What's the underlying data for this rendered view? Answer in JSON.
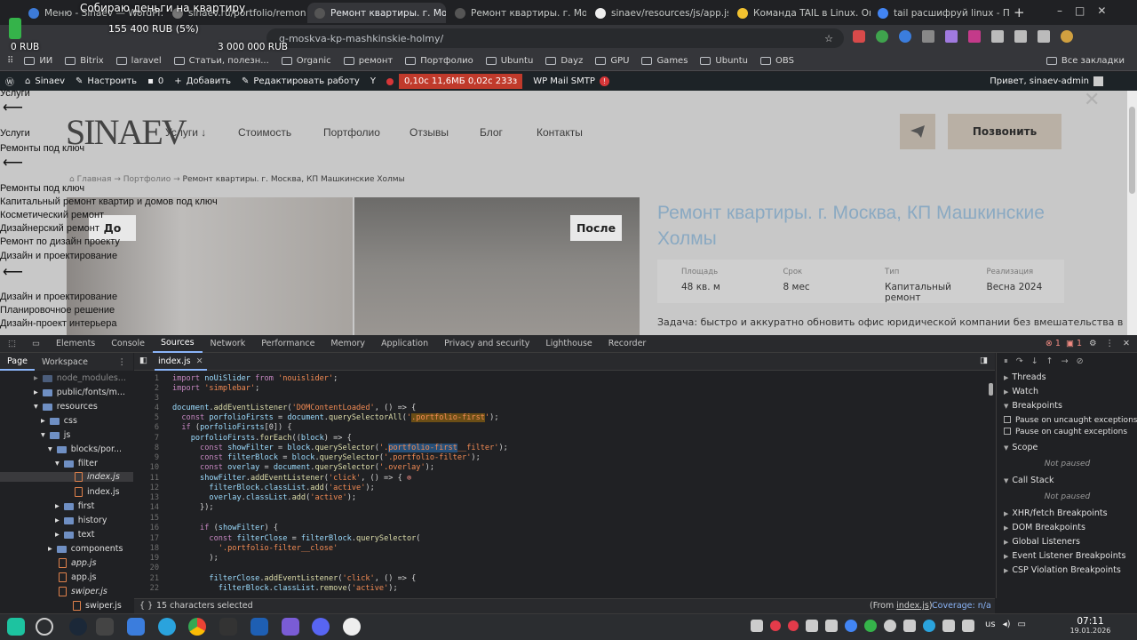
{
  "donation": {
    "title": "Собираю деньги на квартиру",
    "current": "155 400 RUB (5%)",
    "min": "0 RUB",
    "max": "3 000 000 RUB",
    "progress_percent": 5
  },
  "browser": {
    "tabs": [
      {
        "label": "Меню - Sinaev — WordPr...",
        "active": false
      },
      {
        "label": "sinaev.ru/portfolio/remont-k",
        "active": false
      },
      {
        "label": "Ремонт квартиры. г. Моск",
        "active": true
      },
      {
        "label": "Ремонт квартиры. г. Моск",
        "active": false
      },
      {
        "label": "sinaev/resources/js/app.js",
        "active": false
      },
      {
        "label": "Команда TAIL в Linux. Опи",
        "active": false
      },
      {
        "label": "tail расшифруй linux - Пои",
        "active": false
      }
    ],
    "new_tab": "+",
    "url": "g-moskva-kp-mashkinskie-holmy/",
    "bookmarks": [
      "ИИ",
      "Bitrix",
      "laravel",
      "Статьи, полезн...",
      "Organic",
      "ремонт",
      "Портфолио",
      "Ubuntu",
      "Dayz",
      "GPU",
      "Games",
      "Ubuntu",
      "OBS"
    ],
    "all_bookmarks": "Все закладки"
  },
  "wpbar": {
    "site": "Sinaev",
    "customize": "Настроить",
    "comments": "0",
    "add": "Добавить",
    "edit": "Редактировать работу",
    "qm": "0,10с  11,6МБ  0,02с  233з",
    "smtp": "WP Mail SMTP",
    "smtp_badge": "!",
    "greeting": "Привет, sinaev-admin"
  },
  "site": {
    "logo": "SINAEV",
    "nav": [
      "Услуги ↓",
      "Стоимость",
      "Портфолио",
      "Отзывы",
      "Блог",
      "Контакты"
    ],
    "call": "Позвонить",
    "breadcrumbs": {
      "home": "Главная",
      "portfolio": "Портфолио",
      "current": "Ремонт квартиры. г. Москва, КП Машкинские Холмы"
    },
    "before": "До",
    "after": "После",
    "title": "Ремонт квартиры. г. Москва, КП Машкинские Холмы",
    "stats": [
      {
        "k": "Площадь",
        "v": "48 кв. м"
      },
      {
        "k": "Срок",
        "v": "8 мес"
      },
      {
        "k": "Тип",
        "v": "Капитальный ремонт"
      },
      {
        "k": "Реализация",
        "v": "Весна 2024"
      }
    ],
    "task": "Задача: быстро и аккуратно обновить офис юридической компании без вмешательства в"
  },
  "menu": {
    "lines": [
      "Услуги",
      "Услуги",
      "Ремонты под ключ",
      "Ремонты под ключ",
      "Капитальный ремонт квартир и домов под ключ",
      "Косметический ремонт",
      "Дизайнерский ремонт",
      "Ремонт по дизайн проекту",
      "Дизайн и проектирование",
      "Дизайн и проектирование",
      "Планировочное решение",
      "Дизайн-проект интерьера"
    ]
  },
  "devtools": {
    "tabs": [
      "Elements",
      "Console",
      "Sources",
      "Network",
      "Performance",
      "Memory",
      "Application",
      "Privacy and security",
      "Lighthouse",
      "Recorder"
    ],
    "active_tab": "Sources",
    "errors": "1",
    "warnings": "1",
    "sub_tabs": [
      "Page",
      "Workspace"
    ],
    "tree": [
      {
        "label": "node_modules...",
        "type": "folder"
      },
      {
        "label": "public/fonts/m...",
        "type": "folder"
      },
      {
        "label": "resources",
        "type": "folder"
      },
      {
        "label": "css",
        "type": "folder"
      },
      {
        "label": "js",
        "type": "folder"
      },
      {
        "label": "blocks/por...",
        "type": "folder"
      },
      {
        "label": "filter",
        "type": "folder"
      },
      {
        "label": "index.js",
        "type": "file"
      },
      {
        "label": "index.js",
        "type": "file"
      },
      {
        "label": "first",
        "type": "folder"
      },
      {
        "label": "history",
        "type": "folder"
      },
      {
        "label": "text",
        "type": "folder"
      },
      {
        "label": "components",
        "type": "folder"
      },
      {
        "label": "app.js",
        "type": "file"
      },
      {
        "label": "app.js",
        "type": "file"
      },
      {
        "label": "swiper.js",
        "type": "file"
      },
      {
        "label": "swiper.js",
        "type": "file"
      }
    ],
    "editor_tab": "index.js",
    "code_lines": [
      "1",
      "2",
      "3",
      "4",
      "5",
      "6",
      "7",
      "8",
      "9",
      "10",
      "11",
      "12",
      "13",
      "14",
      "15",
      "16",
      "17",
      "18",
      "19",
      "20",
      "21",
      "22"
    ],
    "right": {
      "threads": "Threads",
      "watch": "Watch",
      "breakpoints": "Breakpoints",
      "uncaught": "Pause on uncaught exceptions",
      "caught": "Pause on caught exceptions",
      "scope": "Scope",
      "not_paused": "Not paused",
      "callstack": "Call Stack",
      "not_paused2": "Not paused",
      "xhr": "XHR/fetch Breakpoints",
      "dom": "DOM Breakpoints",
      "global": "Global Listeners",
      "event": "Event Listener Breakpoints",
      "csp": "CSP Violation Breakpoints"
    },
    "status": {
      "selected": "15 characters selected",
      "from": "(From ",
      "from_file": "index.js",
      "from_close": ")",
      "coverage": "Coverage: n/a"
    }
  },
  "taskbar": {
    "time": "07:11",
    "date": "19.01.2026",
    "lang": "us"
  }
}
